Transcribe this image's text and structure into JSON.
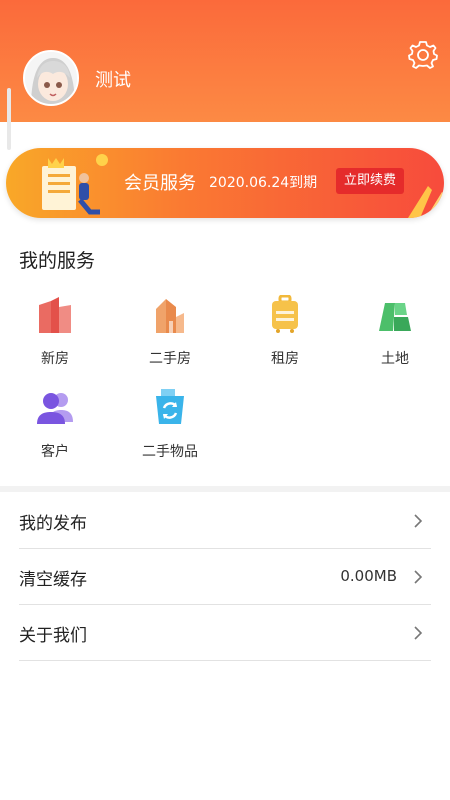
{
  "profile": {
    "username": "测试"
  },
  "member_banner": {
    "title": "会员服务",
    "expiry": "2020.06.24到期",
    "renew_label": "立即续费"
  },
  "services": {
    "title": "我的服务",
    "items": [
      {
        "label": "新房",
        "icon": "new-house-icon"
      },
      {
        "label": "二手房",
        "icon": "second-hand-house-icon"
      },
      {
        "label": "租房",
        "icon": "rent-icon"
      },
      {
        "label": "土地",
        "icon": "land-icon"
      },
      {
        "label": "客户",
        "icon": "customers-icon"
      },
      {
        "label": "二手物品",
        "icon": "second-hand-goods-icon"
      }
    ]
  },
  "menu": {
    "items": [
      {
        "label": "我的发布",
        "value": ""
      },
      {
        "label": "清空缓存",
        "value": "0.00MB"
      },
      {
        "label": "关于我们",
        "value": ""
      }
    ]
  },
  "colors": {
    "header": "#fb6a3b",
    "accent": "#e52b2b"
  }
}
